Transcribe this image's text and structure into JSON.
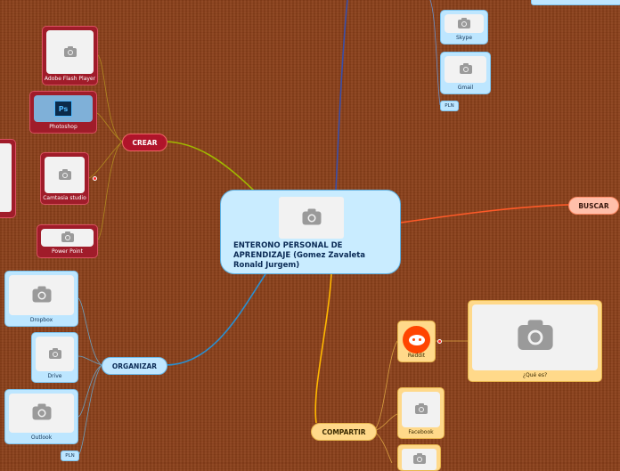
{
  "central": {
    "title": "ENTERONO PERSONAL DE APRENDIZAJE (Gomez Zavaleta Ronald Jurgem)",
    "color": "#c9ecff"
  },
  "branches": {
    "crear": {
      "label": "CREAR",
      "color": "#b0142a",
      "items": [
        "Adobe Flash Player",
        "Photoshop",
        "Camtasia studio",
        "Power Point"
      ]
    },
    "organizar": {
      "label": "ORGANIZAR",
      "color": "#bfe6ff",
      "items": [
        "Dropbox",
        "Drive",
        "Outlook"
      ],
      "tag": "PLN"
    },
    "buscar": {
      "label": "BUSCAR",
      "color": "#ffbfaa"
    },
    "compartir": {
      "label": "COMPARTIR",
      "color": "#ffd98a",
      "items": [
        "Reddit",
        "Facebook"
      ],
      "reddit_detail": "¿Qué es?"
    },
    "comunicar": {
      "items": [
        "Skype",
        "Gmail"
      ],
      "tag": "PLN"
    }
  },
  "icons": {
    "image_placeholder": "camera-icon",
    "photoshop": "photoshop-icon",
    "reddit": "reddit-icon"
  }
}
